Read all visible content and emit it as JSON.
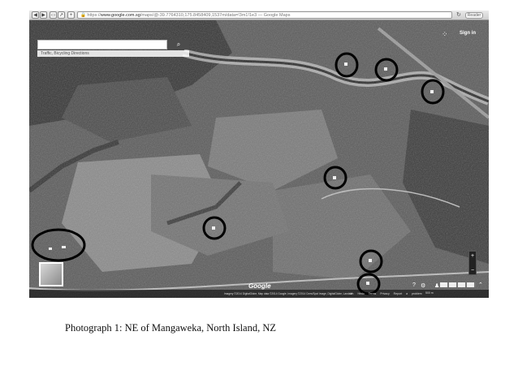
{
  "browser": {
    "url_domain": "www.google.com.sg",
    "url_prefix": "https://",
    "url_rest": "/maps/@-39.7764310,175.8458409,1537m/data=!3m1!1e3 — Google Maps",
    "reader_label": "Reader"
  },
  "maps": {
    "search_value": "",
    "layers_hint": "Traffic, Bicycling Directions",
    "signin_label": "Sign in",
    "logo": "Google",
    "attribution": "Imagery ©2014 DigitalGlobe, Map data ©2014 Google, Imagery ©2014 Cnes/Spot Image, DigitalGlobe, Landsat",
    "footer_links": "Un Hedo  Terms  Privacy  Report a problem",
    "scale": "500 m",
    "zoom_in": "+",
    "zoom_out": "−"
  },
  "caption": "Photograph 1: NE of Mangaweka, North Island, NZ"
}
